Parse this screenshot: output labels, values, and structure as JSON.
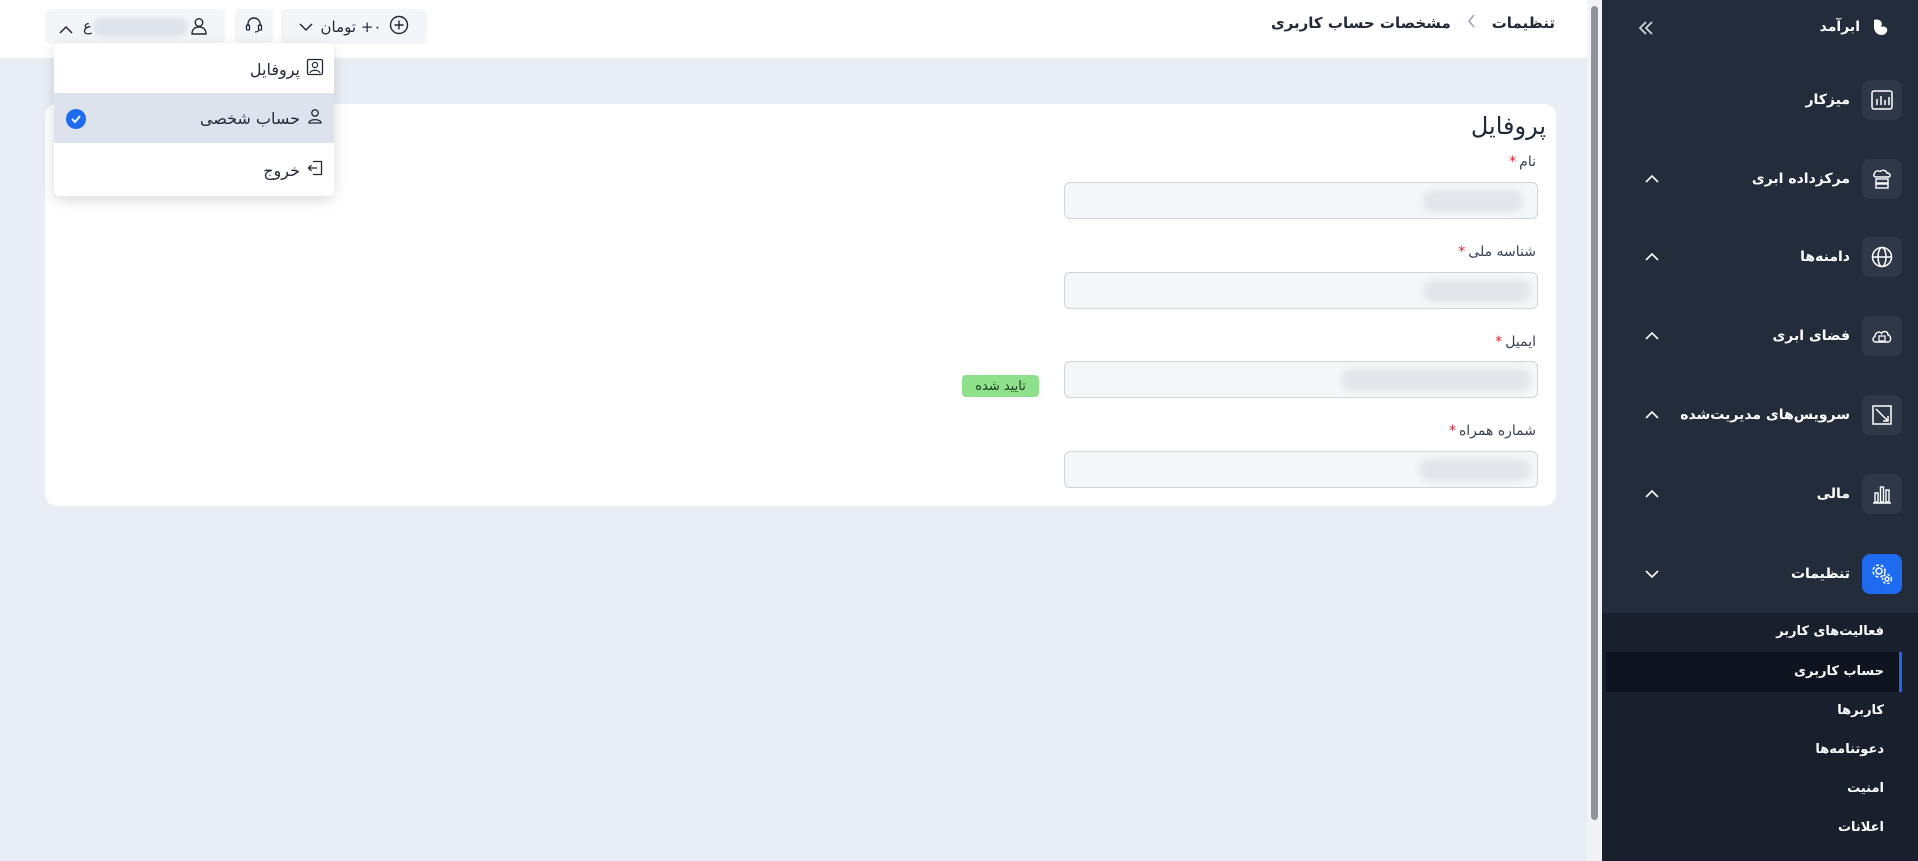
{
  "sidebar": {
    "brand": "ابرآمد",
    "items": [
      {
        "label": "میزکار"
      },
      {
        "label": "مرکزداده ابری"
      },
      {
        "label": "دامنه‌ها"
      },
      {
        "label": "فضای ابری"
      },
      {
        "label": "سرویس‌های مدیریت‌شده"
      },
      {
        "label": "مالی"
      },
      {
        "label": "تنظیمات"
      }
    ],
    "submenu": [
      {
        "label": "فعالیت‌های کاربر"
      },
      {
        "label": "حساب کاربری"
      },
      {
        "label": "کاربرها"
      },
      {
        "label": "دعوتنامه‌ها"
      },
      {
        "label": "امنیت"
      },
      {
        "label": "اعلانات"
      }
    ],
    "active_submenu": "حساب کاربری",
    "accent_color": "#1e6bf0"
  },
  "header": {
    "breadcrumb": [
      "تنظیمات",
      "مشخصات حساب کاربری"
    ],
    "balance": "۰+ تومان",
    "user_name_visible": "ع"
  },
  "user_menu": {
    "items": [
      {
        "label": "پروفایل",
        "icon": "profile-card-icon"
      },
      {
        "label": "حساب شخصی",
        "icon": "person-icon",
        "selected": true
      },
      {
        "label": "خروج",
        "icon": "logout-icon"
      }
    ]
  },
  "profile": {
    "title": "پروفایل",
    "fields": [
      {
        "label": "نام",
        "required": "*"
      },
      {
        "label": "شناسه ملی",
        "required": "*"
      },
      {
        "label": "ایمیل",
        "required": "*",
        "badge": "تایید شده"
      },
      {
        "label": "شماره همراه",
        "required": "*"
      }
    ],
    "badge_color": "#8fe08a"
  }
}
